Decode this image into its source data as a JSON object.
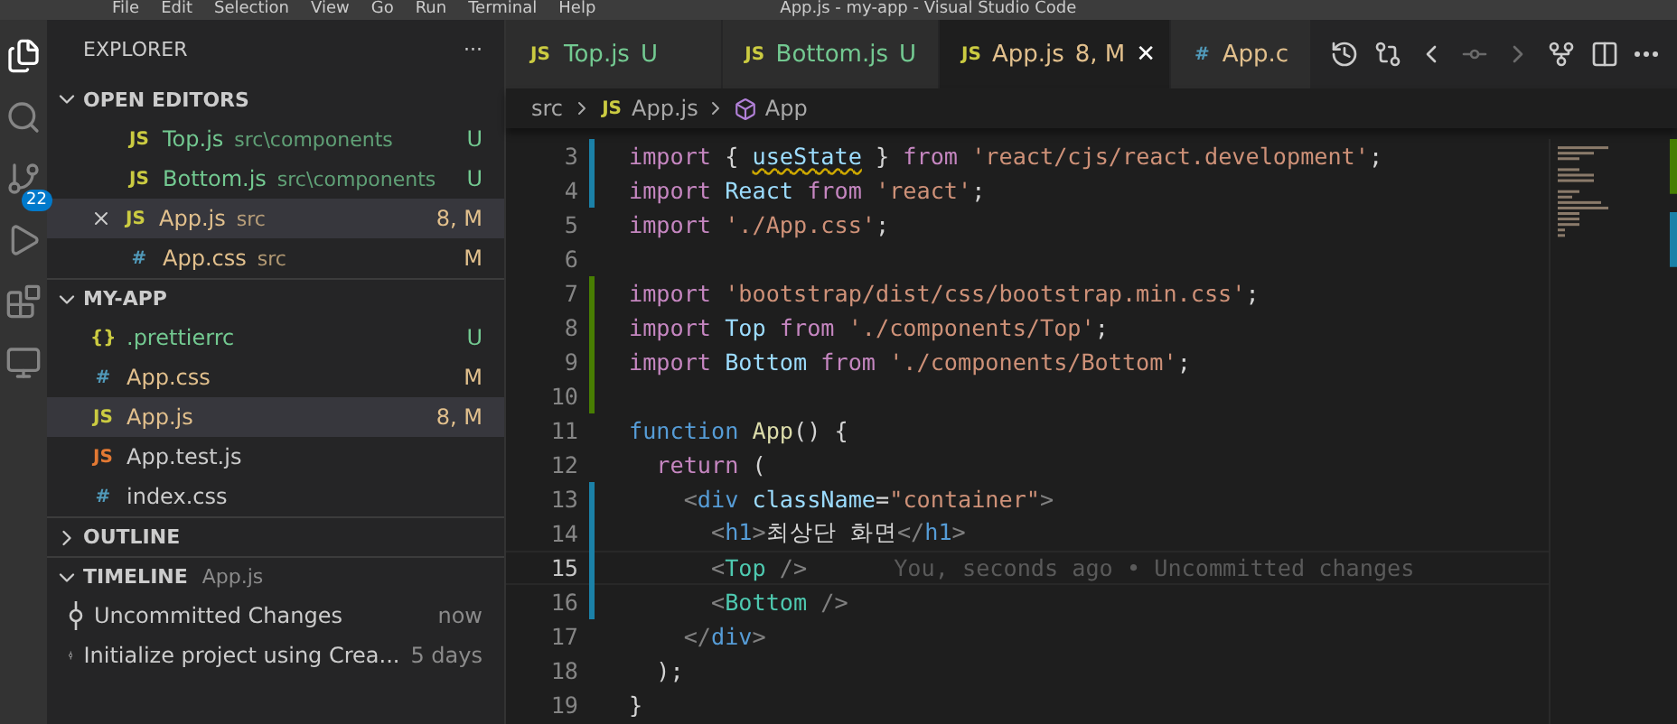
{
  "menu": [
    "File",
    "Edit",
    "Selection",
    "View",
    "Go",
    "Run",
    "Terminal",
    "Help"
  ],
  "window": {
    "title": "App.js - my-app - Visual Studio Code"
  },
  "activity_bar": [
    {
      "kind": "files",
      "selected": true
    },
    {
      "kind": "search",
      "selected": false
    },
    {
      "kind": "scm",
      "selected": false,
      "badge": "22"
    },
    {
      "kind": "debug",
      "selected": false
    },
    {
      "kind": "extensions",
      "selected": false
    },
    {
      "kind": "remote",
      "selected": false
    }
  ],
  "sidebar": {
    "title": "EXPLORER",
    "more": "···",
    "open_editors": {
      "title": "OPEN EDITORS",
      "expanded": true,
      "items": [
        {
          "kind": "js",
          "icon": "JS",
          "name": "Top.js",
          "path": "src\\components",
          "badge": "U",
          "color": "#73c991",
          "selected": false
        },
        {
          "kind": "js",
          "icon": "JS",
          "name": "Bottom.js",
          "path": "src\\components",
          "badge": "U",
          "color": "#73c991",
          "selected": false
        },
        {
          "kind": "js",
          "icon": "JS",
          "name": "App.js",
          "path": "src",
          "badge": "8, M",
          "color": "#e2c08d",
          "selected": true
        },
        {
          "kind": "css",
          "icon": "#",
          "name": "App.css",
          "path": "src",
          "badge": "M",
          "color": "#e2c08d",
          "selected": false
        }
      ]
    },
    "folder": {
      "title": "MY-APP",
      "expanded": true,
      "items": [
        {
          "kind": "json",
          "icon": "{}",
          "name": ".prettierrc",
          "badge": "U",
          "color": "#73c991",
          "selected": false
        },
        {
          "kind": "css",
          "icon": "#",
          "name": "App.css",
          "badge": "M",
          "color": "#e2c08d",
          "selected": false
        },
        {
          "kind": "js",
          "icon": "JS",
          "name": "App.js",
          "badge": "8, M",
          "color": "#e2c08d",
          "selected": true
        },
        {
          "kind": "test",
          "icon": "JS",
          "name": "App.test.js",
          "color": "#cccccc",
          "selected": false
        },
        {
          "kind": "css",
          "icon": "#",
          "name": "index.css",
          "color": "#cccccc",
          "selected": false
        }
      ]
    },
    "outline": {
      "title": "OUTLINE",
      "expanded": false
    },
    "timeline": {
      "title": "TIMELINE",
      "file": "App.js",
      "expanded": true,
      "items": [
        {
          "label": "Uncommitted Changes",
          "time": "now"
        },
        {
          "label": "Initialize project using Crea...",
          "time": "5 days"
        }
      ]
    }
  },
  "tabs": [
    {
      "kind": "js",
      "icon": "JS",
      "name": "Top.js",
      "badge": "U",
      "color": "#73c991",
      "selected": false
    },
    {
      "kind": "js",
      "icon": "JS",
      "name": "Bottom.js",
      "badge": "U",
      "color": "#73c991",
      "selected": false
    },
    {
      "kind": "js",
      "icon": "JS",
      "name": "App.js",
      "badge": "8, M",
      "color": "#e2c08d",
      "selected": true,
      "close": "✕"
    },
    {
      "kind": "css",
      "icon": "#",
      "name": "App.c",
      "color": "#e2c08d",
      "selected": false
    }
  ],
  "toolbar": [
    {
      "kind": "history",
      "disabled": false
    },
    {
      "kind": "compare",
      "disabled": false
    },
    {
      "kind": "prev",
      "disabled": false
    },
    {
      "kind": "commit",
      "disabled": true
    },
    {
      "kind": "next",
      "disabled": true
    },
    {
      "kind": "branch",
      "disabled": false
    },
    {
      "kind": "split",
      "disabled": false
    },
    {
      "kind": "more",
      "disabled": false
    }
  ],
  "breadcrumb": [
    {
      "kind": "folder",
      "text": "src"
    },
    {
      "kind": "js",
      "icon": "JS",
      "text": "App.js"
    },
    {
      "kind": "symbol",
      "text": "App"
    }
  ],
  "editor": {
    "lines": [
      {
        "n": "3",
        "color": "#1b81a8",
        "current": false,
        "tokens": [
          {
            "t": "import ",
            "kind": "kw"
          },
          {
            "t": "{ ",
            "kind": "p"
          },
          {
            "t": "useState",
            "kind": "var",
            "warn": true
          },
          {
            "t": " } ",
            "kind": "p"
          },
          {
            "t": "from ",
            "kind": "kw"
          },
          {
            "t": "'react/cjs/react.development'",
            "kind": "str"
          },
          {
            "t": ";",
            "kind": "p"
          }
        ]
      },
      {
        "n": "4",
        "color": "#1b81a8",
        "current": false,
        "tokens": [
          {
            "t": "import ",
            "kind": "kw"
          },
          {
            "t": "React ",
            "kind": "var"
          },
          {
            "t": "from ",
            "kind": "kw"
          },
          {
            "t": "'react'",
            "kind": "str"
          },
          {
            "t": ";",
            "kind": "p"
          }
        ]
      },
      {
        "n": "5",
        "current": false,
        "tokens": [
          {
            "t": "import ",
            "kind": "kw"
          },
          {
            "t": "'./App.css'",
            "kind": "str"
          },
          {
            "t": ";",
            "kind": "p"
          }
        ]
      },
      {
        "n": "6",
        "current": false
      },
      {
        "n": "7",
        "color": "#487e02",
        "current": false,
        "tokens": [
          {
            "t": "import ",
            "kind": "kw"
          },
          {
            "t": "'bootstrap/dist/css/bootstrap.min.css'",
            "kind": "str"
          },
          {
            "t": ";",
            "kind": "p"
          }
        ]
      },
      {
        "n": "8",
        "color": "#487e02",
        "current": false,
        "tokens": [
          {
            "t": "import ",
            "kind": "kw"
          },
          {
            "t": "Top ",
            "kind": "var"
          },
          {
            "t": "from ",
            "kind": "kw"
          },
          {
            "t": "'./components/Top'",
            "kind": "str"
          },
          {
            "t": ";",
            "kind": "p"
          }
        ]
      },
      {
        "n": "9",
        "color": "#487e02",
        "current": false,
        "tokens": [
          {
            "t": "import ",
            "kind": "kw"
          },
          {
            "t": "Bottom ",
            "kind": "var"
          },
          {
            "t": "from ",
            "kind": "kw"
          },
          {
            "t": "'./components/Bottom'",
            "kind": "str"
          },
          {
            "t": ";",
            "kind": "p"
          }
        ]
      },
      {
        "n": "10",
        "color": "#487e02",
        "current": false
      },
      {
        "n": "11",
        "current": false,
        "tokens": [
          {
            "t": "function ",
            "kind": "fn"
          },
          {
            "t": "App",
            "kind": "name"
          },
          {
            "t": "() {",
            "kind": "p"
          }
        ]
      },
      {
        "n": "12",
        "current": false,
        "tokens": [
          {
            "t": "  return ",
            "kind": "kw"
          },
          {
            "t": "(",
            "kind": "p"
          }
        ]
      },
      {
        "n": "13",
        "color": "#1b81a8",
        "current": false,
        "tokens": [
          {
            "t": "    <",
            "kind": "tag"
          },
          {
            "t": "div ",
            "kind": "fn"
          },
          {
            "t": "className",
            "kind": "var"
          },
          {
            "t": "=",
            "kind": "p"
          },
          {
            "t": "\"container\"",
            "kind": "str"
          },
          {
            "t": ">",
            "kind": "tag"
          }
        ]
      },
      {
        "n": "14",
        "color": "#1b81a8",
        "current": false,
        "tokens": [
          {
            "t": "      <",
            "kind": "tag"
          },
          {
            "t": "h1",
            "kind": "fn"
          },
          {
            "t": ">",
            "kind": "tag"
          },
          {
            "t": "최상단 화면",
            "kind": "p"
          },
          {
            "t": "</",
            "kind": "tag"
          },
          {
            "t": "h1",
            "kind": "fn"
          },
          {
            "t": ">",
            "kind": "tag"
          }
        ]
      },
      {
        "n": "15",
        "color": "#1b81a8",
        "current": true,
        "blame": "You, seconds ago • Uncommitted changes",
        "tokens": [
          {
            "t": "      <",
            "kind": "tag"
          },
          {
            "t": "Top",
            "kind": "comp"
          },
          {
            "t": " />",
            "kind": "tag"
          }
        ]
      },
      {
        "n": "16",
        "color": "#1b81a8",
        "current": false,
        "tokens": [
          {
            "t": "      <",
            "kind": "tag"
          },
          {
            "t": "Bottom",
            "kind": "comp"
          },
          {
            "t": " />",
            "kind": "tag"
          }
        ]
      },
      {
        "n": "17",
        "current": false,
        "tokens": [
          {
            "t": "    </",
            "kind": "tag"
          },
          {
            "t": "div",
            "kind": "fn"
          },
          {
            "t": ">",
            "kind": "tag"
          }
        ]
      },
      {
        "n": "18",
        "current": false,
        "tokens": [
          {
            "t": "  );",
            "kind": "p"
          }
        ]
      },
      {
        "n": "19",
        "current": false,
        "tokens": [
          {
            "t": "}",
            "kind": "p"
          }
        ]
      }
    ]
  }
}
